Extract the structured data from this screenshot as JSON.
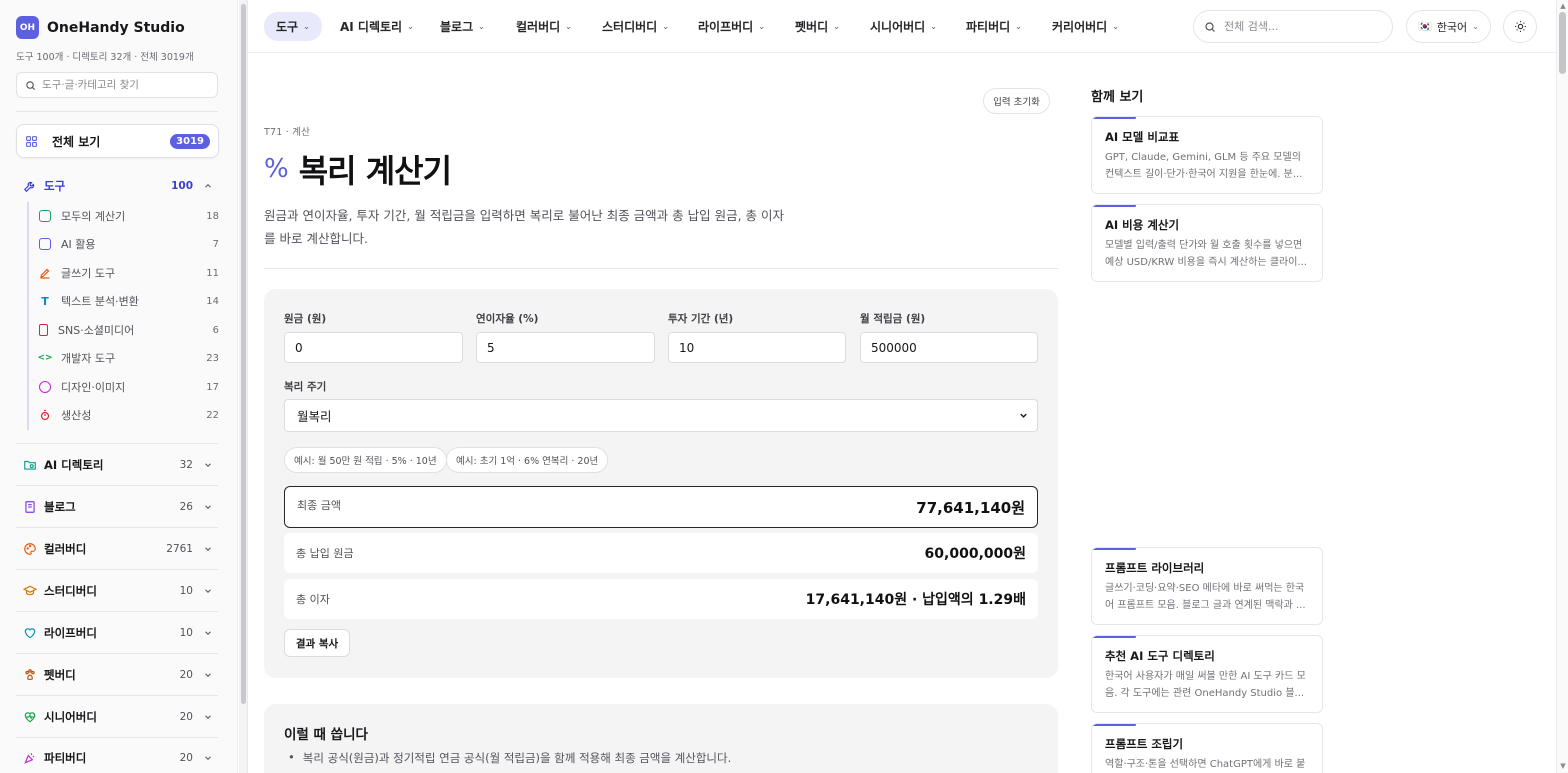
{
  "brand": {
    "logo": "OH",
    "name": "OneHandy Studio",
    "meta": "도구 100개 · 디렉토리 32개 · 전체 3019개"
  },
  "sidebar": {
    "search_placeholder": "도구·글·카테고리 찾기",
    "all_view": {
      "label": "전체 보기",
      "count": "3019"
    },
    "categories": [
      {
        "label": "도구",
        "count": "100",
        "icon": "wrench-icon",
        "color": "#3b3fc9"
      },
      {
        "label": "AI 디렉토리",
        "count": "32",
        "icon": "folder-search-icon",
        "color": "#0e9f8e"
      },
      {
        "label": "블로그",
        "count": "26",
        "icon": "book-icon",
        "color": "#7c3aed"
      },
      {
        "label": "컬러버디",
        "count": "2761",
        "icon": "palette-icon",
        "color": "#ea580c"
      },
      {
        "label": "스터디버디",
        "count": "10",
        "icon": "graduation-cap-icon",
        "color": "#d97706"
      },
      {
        "label": "라이프버디",
        "count": "10",
        "icon": "heart-icon",
        "color": "#0891b2"
      },
      {
        "label": "펫버디",
        "count": "20",
        "icon": "paw-icon",
        "color": "#b45309"
      },
      {
        "label": "시니어버디",
        "count": "20",
        "icon": "heart-pulse-icon",
        "color": "#16a34a"
      },
      {
        "label": "파티버디",
        "count": "20",
        "icon": "party-popper-icon",
        "color": "#c026d3"
      }
    ],
    "tools_sub": [
      {
        "label": "모두의 계산기",
        "count": "18",
        "icon": "calculator-icon",
        "color": "#22a06b"
      },
      {
        "label": "AI 활용",
        "count": "7",
        "icon": "bot-icon",
        "color": "#5b5fe0"
      },
      {
        "label": "글쓰기 도구",
        "count": "11",
        "icon": "pen-icon",
        "color": "#ea580c"
      },
      {
        "label": "텍스트 분석·변환",
        "count": "14",
        "icon": "text-icon",
        "color": "#0891b2"
      },
      {
        "label": "SNS·소셜미디어",
        "count": "6",
        "icon": "smartphone-icon",
        "color": "#e11d48"
      },
      {
        "label": "개발자 도구",
        "count": "23",
        "icon": "code-icon",
        "color": "#16a34a"
      },
      {
        "label": "디자인·이미지",
        "count": "17",
        "icon": "palette-icon",
        "color": "#c026d3"
      },
      {
        "label": "생산성",
        "count": "22",
        "icon": "timer-icon",
        "color": "#dc2626"
      }
    ]
  },
  "topnav": {
    "items": [
      "도구",
      "AI 디렉토리",
      "블로그",
      "컬러버디",
      "스터디버디",
      "라이프버디",
      "펫버디",
      "시니어버디",
      "파티버디",
      "커리어버디"
    ],
    "search_placeholder": "전체 검색...",
    "language": "한국어",
    "flag": "🇰🇷"
  },
  "page": {
    "reset_label": "입력 초기화",
    "crumb": "T71 · 계산",
    "title_icon": "%",
    "title": "복리 계산기",
    "description": "원금과 연이자율, 투자 기간, 월 적립금을 입력하면 복리로 불어난 최종 금액과 총 납입 원금, 총 이자를 바로 계산합니다."
  },
  "calculator": {
    "fields": [
      {
        "label": "원금 (원)",
        "value": "0"
      },
      {
        "label": "연이자율 (%)",
        "value": "5"
      },
      {
        "label": "투자 기간 (년)",
        "value": "10"
      },
      {
        "label": "월 적립금 (원)",
        "value": "500000"
      }
    ],
    "period_label": "복리 주기",
    "period_value": "월복리",
    "examples": [
      "예시: 월 50만 원 적립 · 5% · 10년",
      "예시: 초기 1억 · 6% 연복리 · 20년"
    ],
    "results": [
      {
        "label": "최종 금액",
        "value": "77,641,140원"
      },
      {
        "label": "총 납입 원금",
        "value": "60,000,000원"
      },
      {
        "label": "총 이자",
        "value": "17,641,140원 · 납입액의 1.29배"
      }
    ],
    "copy_label": "결과 복사"
  },
  "usecase": {
    "title": "이럴 때 씁니다",
    "bullet": "복리 공식(원금)과 정기적립 연금 공식(월 적립금)을 함께 적용해 최종 금액을 계산합니다."
  },
  "right_rail": {
    "title": "함께 보기",
    "cards_top": [
      {
        "title": "AI 모델 비교표",
        "desc": "GPT, Claude, Gemini, GLM 등 주요 모델의 컨텍스트 길이·단가·한국어 지원을 한눈에. 분..."
      },
      {
        "title": "AI 비용 계산기",
        "desc": "모델별 입력/출력 단가와 월 호출 횟수를 넣으면 예상 USD/KRW 비용을 즉시 계산하는 클라이..."
      }
    ],
    "cards_bottom": [
      {
        "title": "프롬프트 라이브러리",
        "desc": "글쓰기·코딩·요약·SEO 메타에 바로 써먹는 한국어 프롬프트 모음. 블로그 글과 연계된 맥락과 ..."
      },
      {
        "title": "추천 AI 도구 디렉토리",
        "desc": "한국어 사용자가 매일 써볼 만한 AI 도구 카드 모음. 각 도구에는 관련 OneHandy Studio 블..."
      },
      {
        "title": "프롬프트 조립기",
        "desc": "역할·구조·톤을 선택하면 ChatGPT에게 바로 붙"
      }
    ]
  },
  "colors": {
    "accent": "#5b5fe0",
    "accent_soft": "#e8e9fb",
    "panel": "#f4f4f5"
  }
}
